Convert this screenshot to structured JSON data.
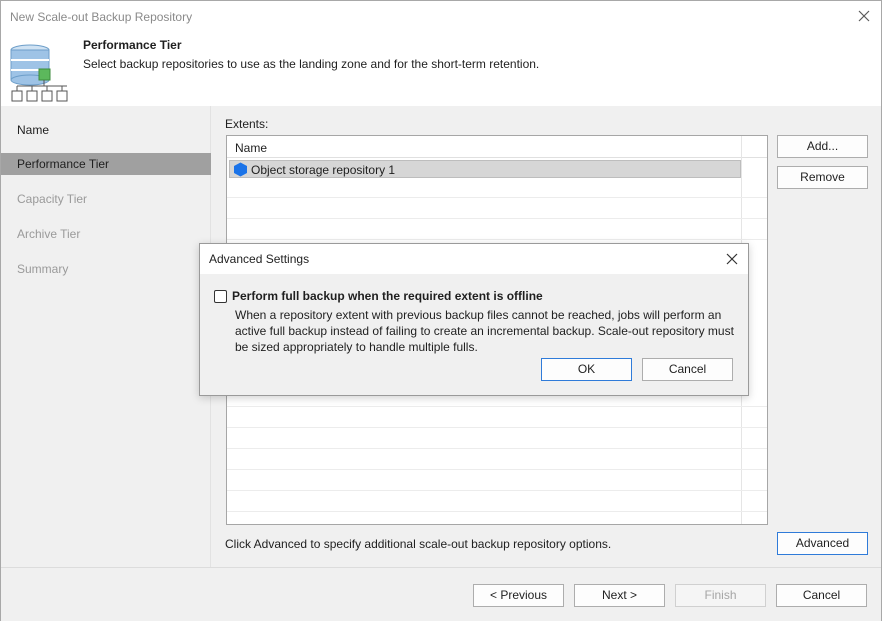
{
  "window": {
    "title": "New Scale-out Backup Repository"
  },
  "header": {
    "title": "Performance Tier",
    "description": "Select backup repositories to use as the landing zone and for the short-term retention."
  },
  "sidebar": {
    "items": [
      {
        "label": "Name",
        "state": "normal"
      },
      {
        "label": "Performance Tier",
        "state": "active"
      },
      {
        "label": "Capacity Tier",
        "state": "disabled"
      },
      {
        "label": "Archive Tier",
        "state": "disabled"
      },
      {
        "label": "Summary",
        "state": "disabled"
      }
    ]
  },
  "main": {
    "extents_label": "Extents:",
    "list": {
      "column_header": "Name",
      "rows": [
        {
          "name": "Object storage repository 1",
          "icon": "hexagon-icon"
        }
      ]
    },
    "add_label": "Add...",
    "remove_label": "Remove",
    "hint": "Click Advanced to specify additional scale-out backup repository options.",
    "advanced_label": "Advanced"
  },
  "footer": {
    "previous_label": "< Previous",
    "next_label": "Next >",
    "finish_label": "Finish",
    "cancel_label": "Cancel"
  },
  "dialog": {
    "title": "Advanced Settings",
    "checkbox_label": "Perform full backup when the required extent is offline",
    "checkbox_checked": false,
    "description": "When a repository extent with previous backup files cannot be reached, jobs will perform an active full backup instead of failing to create an incremental backup. Scale-out repository must be sized appropriately to handle multiple fulls.",
    "ok_label": "OK",
    "cancel_label": "Cancel"
  },
  "colors": {
    "accent_border": "#2f7bd9",
    "repo_icon_blue": "#1a73e8",
    "selected_sidebar": "#a0a0a0",
    "db_icon_blue": "#9ec3e6",
    "db_icon_green": "#5cb85c"
  }
}
